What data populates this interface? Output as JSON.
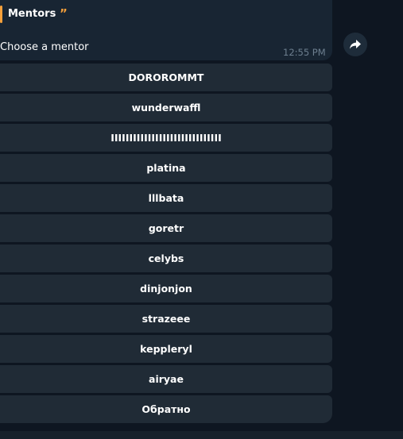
{
  "reply": {
    "title": "Mentors",
    "quote_glyph": "”"
  },
  "message": {
    "text": "Choose a mentor",
    "time": "12:55 PM"
  },
  "keyboard": {
    "buttons": [
      {
        "label": "DOROROMMT"
      },
      {
        "label": "wunderwaffl"
      },
      {
        "label": "IIIIIIIIIIIIIIIIIIIIIIIIIIIIII"
      },
      {
        "label": "platina"
      },
      {
        "label": "lllbata"
      },
      {
        "label": "goretr"
      },
      {
        "label": "celybs"
      },
      {
        "label": "dinjonjon"
      },
      {
        "label": "strazeee"
      },
      {
        "label": "keppleryl"
      },
      {
        "label": "airyae"
      },
      {
        "label": "Обратно"
      }
    ]
  },
  "icons": {
    "forward": "forward-arrow-icon"
  },
  "colors": {
    "background": "#0e1621",
    "bubble": "#182533",
    "button": "#202b36",
    "accent": "#f5a03b",
    "timestamp": "#6d7f8f"
  }
}
